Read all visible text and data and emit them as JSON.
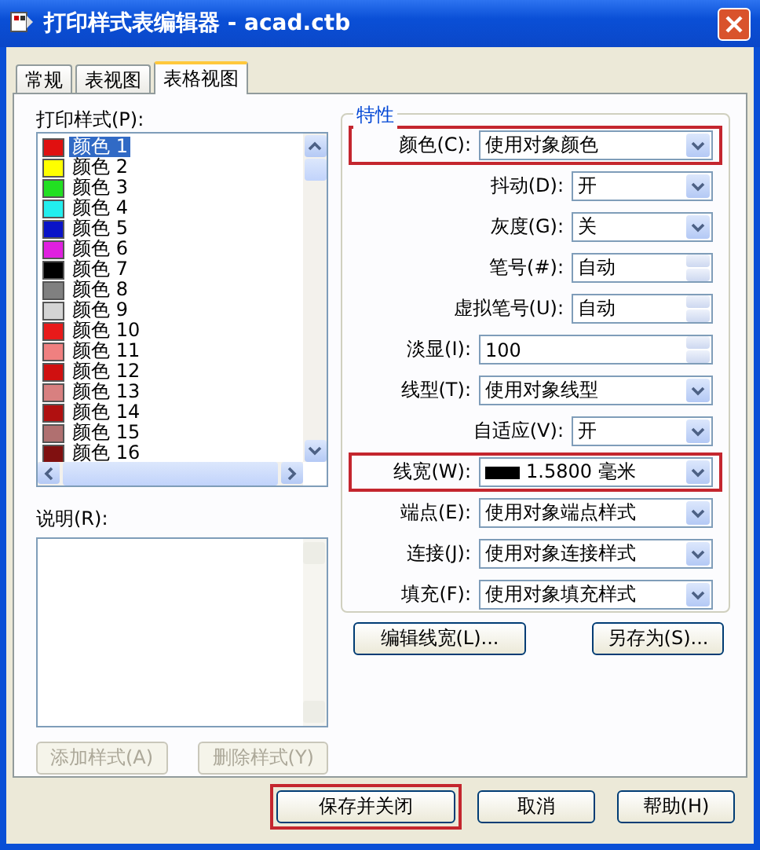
{
  "window": {
    "title": "打印样式表编辑器 - acad.ctb"
  },
  "tabs": [
    {
      "label": "常规",
      "selected": false
    },
    {
      "label": "表视图",
      "selected": false
    },
    {
      "label": "表格视图",
      "selected": true
    }
  ],
  "styles": {
    "label": "打印样式(P):",
    "items": [
      {
        "name": "颜色 1",
        "color": "#e01010",
        "selected": true
      },
      {
        "name": "颜色 2",
        "color": "#ffff00",
        "selected": false
      },
      {
        "name": "颜色 3",
        "color": "#22e022",
        "selected": false
      },
      {
        "name": "颜色 4",
        "color": "#22eeee",
        "selected": false
      },
      {
        "name": "颜色 5",
        "color": "#0a14c8",
        "selected": false
      },
      {
        "name": "颜色 6",
        "color": "#e020e0",
        "selected": false
      },
      {
        "name": "颜色 7",
        "color": "#000000",
        "selected": false
      },
      {
        "name": "颜色 8",
        "color": "#808080",
        "selected": false
      },
      {
        "name": "颜色 9",
        "color": "#d4d4d4",
        "selected": false
      },
      {
        "name": "颜色 10",
        "color": "#e81a1a",
        "selected": false
      },
      {
        "name": "颜色 11",
        "color": "#f08080",
        "selected": false
      },
      {
        "name": "颜色 12",
        "color": "#d01010",
        "selected": false
      },
      {
        "name": "颜色 13",
        "color": "#d88080",
        "selected": false
      },
      {
        "name": "颜色 14",
        "color": "#b01010",
        "selected": false
      },
      {
        "name": "颜色 15",
        "color": "#b07070",
        "selected": false
      },
      {
        "name": "颜色 16",
        "color": "#801010",
        "selected": false
      }
    ]
  },
  "description": {
    "label": "说明(R):"
  },
  "style_buttons": [
    {
      "label": "添加样式(A)",
      "disabled": true
    },
    {
      "label": "删除样式(Y)",
      "disabled": true
    }
  ],
  "properties": {
    "title": "特性",
    "fields": [
      {
        "label": "颜色(C):",
        "kind": "combo",
        "value": "使用对象颜色",
        "highlighted": true
      },
      {
        "label": "抖动(D):",
        "kind": "short-combo",
        "value": "开",
        "highlighted": false
      },
      {
        "label": "灰度(G):",
        "kind": "short-combo",
        "value": "关",
        "highlighted": false
      },
      {
        "label": "笔号(#):",
        "kind": "short-spin",
        "value": "自动",
        "highlighted": false
      },
      {
        "label": "虚拟笔号(U):",
        "kind": "short-spin",
        "value": "自动",
        "highlighted": false
      },
      {
        "label": "淡显(I):",
        "kind": "spin",
        "value": "100",
        "highlighted": false
      },
      {
        "label": "线型(T):",
        "kind": "combo",
        "value": "使用对象线型",
        "highlighted": false
      },
      {
        "label": "自适应(V):",
        "kind": "short-combo",
        "value": "开",
        "highlighted": false
      },
      {
        "label": "线宽(W):",
        "kind": "lineweight",
        "value": "1.5800 毫米",
        "highlighted": true
      },
      {
        "label": "端点(E):",
        "kind": "combo",
        "value": "使用对象端点样式",
        "highlighted": false
      },
      {
        "label": "连接(J):",
        "kind": "combo",
        "value": "使用对象连接样式",
        "highlighted": false
      },
      {
        "label": "填充(F):",
        "kind": "combo",
        "value": "使用对象填充样式",
        "highlighted": false
      }
    ]
  },
  "property_buttons": [
    {
      "label": "编辑线宽(L)..."
    },
    {
      "label": "另存为(S)..."
    }
  ],
  "footer_buttons": [
    {
      "label": "保存并关闭",
      "highlighted": true
    },
    {
      "label": "取消",
      "highlighted": false
    },
    {
      "label": "帮助(H)",
      "highlighted": false
    }
  ]
}
